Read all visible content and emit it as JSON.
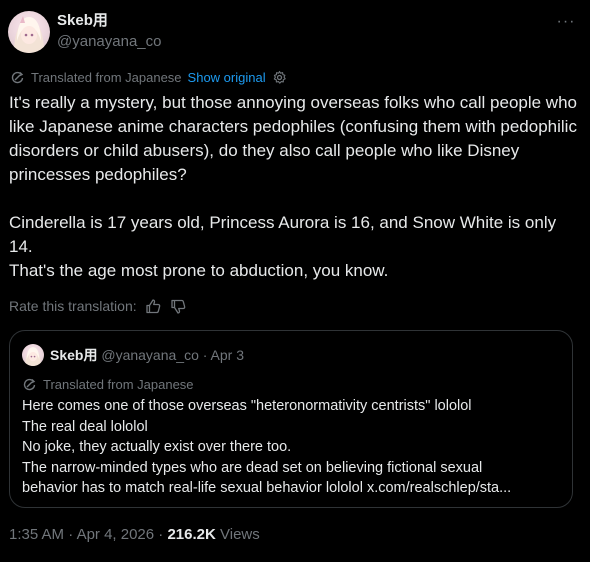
{
  "author": {
    "display_name": "Skeb用",
    "handle": "@yanayana_co"
  },
  "more_label": "···",
  "translation": {
    "label": "Translated from Japanese",
    "show_original": "Show original"
  },
  "tweet": {
    "lines": [
      "It's really a mystery, but those annoying overseas folks who call people who like Japanese anime characters pedophiles (confusing them with pedophilic disorders or child abusers), do they also call people who like Disney princesses pedophiles?",
      "Cinderella is 17 years old, Princess Aurora is 16, and Snow White is only 14.",
      "That's the age most prone to abduction, you know."
    ]
  },
  "rate": {
    "label": "Rate this translation:"
  },
  "quote": {
    "display_name": "Skeb用",
    "handle": "@yanayana_co",
    "separator": " · ",
    "date": "Apr 3",
    "translation_label": "Translated from Japanese",
    "lines": [
      "Here comes one of those overseas \"heteronormativity centrists\" lololol",
      "The real deal lololol",
      "No joke, they actually exist over there too.",
      "The narrow-minded types who are dead set on believing fictional sexual",
      "behavior has to match real-life sexual behavior lololol x.com/realschlep/sta..."
    ]
  },
  "footer": {
    "time": "1:35 AM",
    "separator": " · ",
    "date": "Apr 4, 2026",
    "views_count": "216.2K",
    "views_label": " Views"
  },
  "colors": {
    "background": "#000000",
    "text": "#e7e9ea",
    "secondary": "#71767b",
    "link": "#1d9bf0",
    "border": "#2f3336"
  }
}
